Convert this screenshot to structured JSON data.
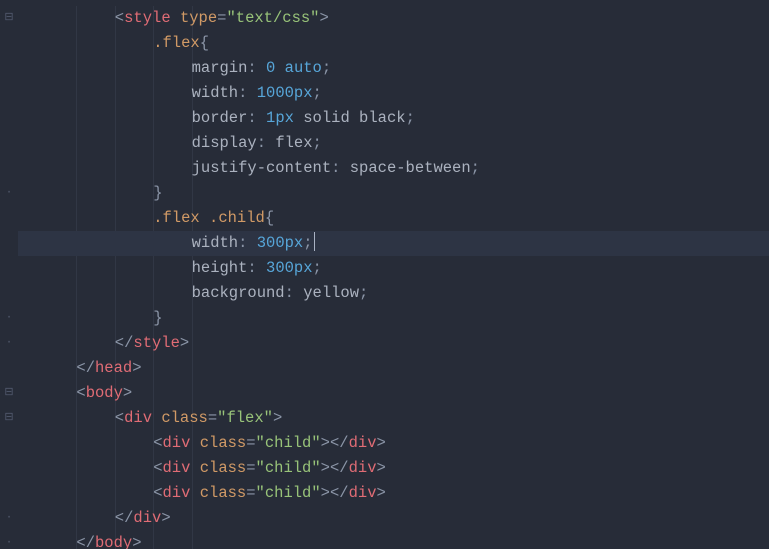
{
  "gutter": {
    "fold_minus": "⊟",
    "fold_plus": "",
    "dot": "·"
  },
  "code": {
    "lines": [
      {
        "indent": 8,
        "tokens": [
          {
            "t": "<",
            "c": "punct"
          },
          {
            "t": "style",
            "c": "tag"
          },
          {
            "t": " ",
            "c": "prop"
          },
          {
            "t": "type",
            "c": "attr"
          },
          {
            "t": "=",
            "c": "punct"
          },
          {
            "t": "\"text/css\"",
            "c": "str"
          },
          {
            "t": ">",
            "c": "punct"
          }
        ]
      },
      {
        "indent": 12,
        "tokens": [
          {
            "t": ".flex",
            "c": "ident"
          },
          {
            "t": "{",
            "c": "punct"
          }
        ]
      },
      {
        "indent": 16,
        "tokens": [
          {
            "t": "margin",
            "c": "prop"
          },
          {
            "t": ": ",
            "c": "punct"
          },
          {
            "t": "0",
            "c": "num"
          },
          {
            "t": " ",
            "c": "prop"
          },
          {
            "t": "auto",
            "c": "num"
          },
          {
            "t": ";",
            "c": "punct"
          }
        ]
      },
      {
        "indent": 16,
        "tokens": [
          {
            "t": "width",
            "c": "prop"
          },
          {
            "t": ": ",
            "c": "punct"
          },
          {
            "t": "1000px",
            "c": "num"
          },
          {
            "t": ";",
            "c": "punct"
          }
        ]
      },
      {
        "indent": 16,
        "tokens": [
          {
            "t": "border",
            "c": "prop"
          },
          {
            "t": ": ",
            "c": "punct"
          },
          {
            "t": "1px",
            "c": "num"
          },
          {
            "t": " ",
            "c": "prop"
          },
          {
            "t": "solid black",
            "c": "prop"
          },
          {
            "t": ";",
            "c": "punct"
          }
        ]
      },
      {
        "indent": 16,
        "tokens": [
          {
            "t": "display",
            "c": "prop"
          },
          {
            "t": ": ",
            "c": "punct"
          },
          {
            "t": "flex",
            "c": "prop"
          },
          {
            "t": ";",
            "c": "punct"
          }
        ]
      },
      {
        "indent": 16,
        "tokens": [
          {
            "t": "justify-content",
            "c": "prop"
          },
          {
            "t": ": ",
            "c": "punct"
          },
          {
            "t": "space-between",
            "c": "prop"
          },
          {
            "t": ";",
            "c": "punct"
          }
        ]
      },
      {
        "indent": 12,
        "tokens": [
          {
            "t": "}",
            "c": "punct"
          }
        ]
      },
      {
        "indent": 12,
        "tokens": [
          {
            "t": ".flex",
            "c": "ident"
          },
          {
            "t": " ",
            "c": "prop"
          },
          {
            "t": ".child",
            "c": "ident"
          },
          {
            "t": "{",
            "c": "punct"
          }
        ]
      },
      {
        "indent": 16,
        "caret": true,
        "active": true,
        "tokens": [
          {
            "t": "width",
            "c": "prop"
          },
          {
            "t": ": ",
            "c": "punct"
          },
          {
            "t": "300px",
            "c": "num"
          },
          {
            "t": ";",
            "c": "punct"
          }
        ]
      },
      {
        "indent": 16,
        "tokens": [
          {
            "t": "height",
            "c": "prop"
          },
          {
            "t": ": ",
            "c": "punct"
          },
          {
            "t": "300px",
            "c": "num"
          },
          {
            "t": ";",
            "c": "punct"
          }
        ]
      },
      {
        "indent": 16,
        "tokens": [
          {
            "t": "background",
            "c": "prop"
          },
          {
            "t": ": ",
            "c": "punct"
          },
          {
            "t": "yellow",
            "c": "prop"
          },
          {
            "t": ";",
            "c": "punct"
          }
        ]
      },
      {
        "indent": 12,
        "tokens": [
          {
            "t": "}",
            "c": "punct"
          }
        ]
      },
      {
        "indent": 8,
        "tokens": [
          {
            "t": "</",
            "c": "punct"
          },
          {
            "t": "style",
            "c": "tag"
          },
          {
            "t": ">",
            "c": "punct"
          }
        ]
      },
      {
        "indent": 4,
        "tokens": [
          {
            "t": "</",
            "c": "punct"
          },
          {
            "t": "head",
            "c": "tag"
          },
          {
            "t": ">",
            "c": "punct"
          }
        ]
      },
      {
        "indent": 4,
        "tokens": [
          {
            "t": "<",
            "c": "punct"
          },
          {
            "t": "body",
            "c": "tag"
          },
          {
            "t": ">",
            "c": "punct"
          }
        ]
      },
      {
        "indent": 8,
        "tokens": [
          {
            "t": "<",
            "c": "punct"
          },
          {
            "t": "div",
            "c": "tag"
          },
          {
            "t": " ",
            "c": "prop"
          },
          {
            "t": "class",
            "c": "attr"
          },
          {
            "t": "=",
            "c": "punct"
          },
          {
            "t": "\"flex\"",
            "c": "str"
          },
          {
            "t": ">",
            "c": "punct"
          }
        ]
      },
      {
        "indent": 12,
        "tokens": [
          {
            "t": "<",
            "c": "punct"
          },
          {
            "t": "div",
            "c": "tag"
          },
          {
            "t": " ",
            "c": "prop"
          },
          {
            "t": "class",
            "c": "attr"
          },
          {
            "t": "=",
            "c": "punct"
          },
          {
            "t": "\"child\"",
            "c": "str"
          },
          {
            "t": ">",
            "c": "punct"
          },
          {
            "t": "</",
            "c": "punct"
          },
          {
            "t": "div",
            "c": "tag"
          },
          {
            "t": ">",
            "c": "punct"
          }
        ]
      },
      {
        "indent": 12,
        "tokens": [
          {
            "t": "<",
            "c": "punct"
          },
          {
            "t": "div",
            "c": "tag"
          },
          {
            "t": " ",
            "c": "prop"
          },
          {
            "t": "class",
            "c": "attr"
          },
          {
            "t": "=",
            "c": "punct"
          },
          {
            "t": "\"child\"",
            "c": "str"
          },
          {
            "t": ">",
            "c": "punct"
          },
          {
            "t": "</",
            "c": "punct"
          },
          {
            "t": "div",
            "c": "tag"
          },
          {
            "t": ">",
            "c": "punct"
          }
        ]
      },
      {
        "indent": 12,
        "tokens": [
          {
            "t": "<",
            "c": "punct"
          },
          {
            "t": "div",
            "c": "tag"
          },
          {
            "t": " ",
            "c": "prop"
          },
          {
            "t": "class",
            "c": "attr"
          },
          {
            "t": "=",
            "c": "punct"
          },
          {
            "t": "\"child\"",
            "c": "str"
          },
          {
            "t": ">",
            "c": "punct"
          },
          {
            "t": "</",
            "c": "punct"
          },
          {
            "t": "div",
            "c": "tag"
          },
          {
            "t": ">",
            "c": "punct"
          }
        ]
      },
      {
        "indent": 8,
        "tokens": [
          {
            "t": "</",
            "c": "punct"
          },
          {
            "t": "div",
            "c": "tag"
          },
          {
            "t": ">",
            "c": "punct"
          }
        ]
      },
      {
        "indent": 4,
        "tokens": [
          {
            "t": "</",
            "c": "punct"
          },
          {
            "t": "body",
            "c": "tag"
          },
          {
            "t": ">",
            "c": "punct"
          }
        ]
      }
    ],
    "gutter_marks": [
      "⊟",
      "",
      "",
      "",
      "",
      "",
      "",
      "·",
      "",
      "",
      "",
      "",
      "·",
      "·",
      "",
      "⊟",
      "⊟",
      "",
      "",
      "",
      "·",
      "·"
    ]
  }
}
